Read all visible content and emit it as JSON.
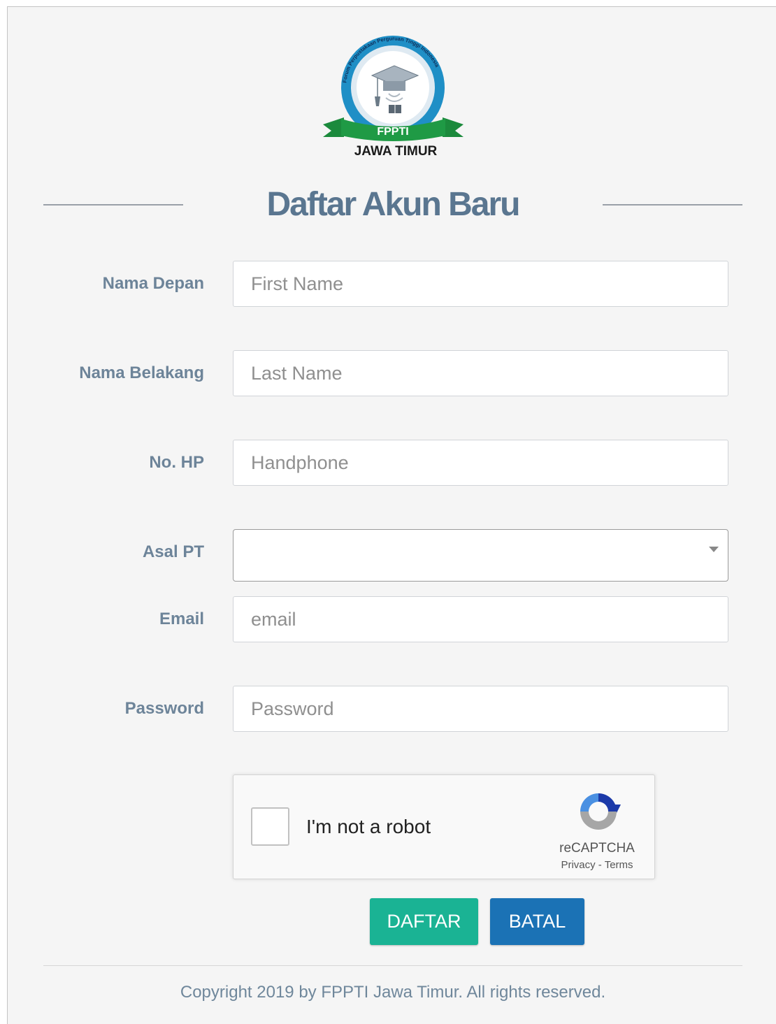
{
  "logo": {
    "ribbon_text": "FPPTI",
    "region_text": "JAWA TIMUR",
    "ring_text": "Forum Perpustakaan Perguruan Tinggi Indonesia",
    "icon": "graduation-cap-logo"
  },
  "page_title": "Daftar Akun Baru",
  "form": {
    "first_name": {
      "label": "Nama Depan",
      "placeholder": "First Name",
      "value": ""
    },
    "last_name": {
      "label": "Nama Belakang",
      "placeholder": "Last Name",
      "value": ""
    },
    "phone": {
      "label": "No. HP",
      "placeholder": "Handphone",
      "value": ""
    },
    "institution": {
      "label": "Asal PT",
      "selected": ""
    },
    "email": {
      "label": "Email",
      "placeholder": "email",
      "value": ""
    },
    "password": {
      "label": "Password",
      "placeholder": "Password",
      "value": ""
    }
  },
  "captcha": {
    "label": "I'm not a robot",
    "brand": "reCAPTCHA",
    "privacy": "Privacy",
    "separator": " - ",
    "terms": "Terms"
  },
  "buttons": {
    "submit": "DAFTAR",
    "cancel": "BATAL"
  },
  "footer": "Copyright 2019 by FPPTI Jawa Timur. All rights reserved.",
  "colors": {
    "submit": "#1ab394",
    "cancel": "#1b72b5",
    "title": "#5a7690",
    "label": "#6d8499",
    "logo_ring": "#1f8fc6",
    "logo_ribbon": "#1b8a3c"
  }
}
